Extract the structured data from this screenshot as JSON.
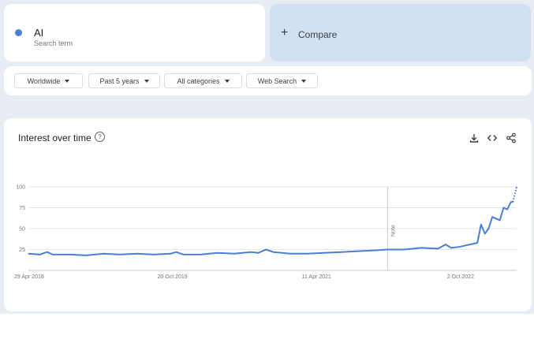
{
  "search_term": {
    "name": "AI",
    "subtitle": "Search term",
    "color": "#4a7fd6"
  },
  "compare": {
    "plus": "+",
    "label": "Compare"
  },
  "filters": [
    {
      "label": "Worldwide"
    },
    {
      "label": "Past 5 years"
    },
    {
      "label": "All categories"
    },
    {
      "label": "Web Search"
    }
  ],
  "chart_card": {
    "title": "Interest over time",
    "help_icon": "?",
    "icons": [
      "download-icon",
      "embed-code-icon",
      "share-icon"
    ]
  },
  "chart_data": {
    "type": "line",
    "title": "",
    "xlabel": "",
    "ylabel": "",
    "ylim": [
      0,
      100
    ],
    "yticks": [
      25,
      50,
      75,
      100
    ],
    "x_start": "29 Apr 2018",
    "x_end": "2023-04-30",
    "x_tick_labels": [
      {
        "label": "29 Apr 2018",
        "date": "2018-04-29"
      },
      {
        "label": "20 Oct 2019",
        "date": "2019-10-20"
      },
      {
        "label": "11 Apr 2021",
        "date": "2021-04-11"
      },
      {
        "label": "2 Oct 2022",
        "date": "2022-10-02"
      }
    ],
    "annotation": {
      "label": "Note",
      "date": "2022-01-02"
    },
    "partial_from": "2023-04-16",
    "grid": true,
    "series": [
      {
        "name": "AI",
        "color": "#4a7fd6",
        "points": [
          [
            "2018-04-29",
            20
          ],
          [
            "2018-06-10",
            19
          ],
          [
            "2018-07-08",
            22
          ],
          [
            "2018-07-29",
            19
          ],
          [
            "2018-09-30",
            19
          ],
          [
            "2018-12-02",
            18
          ],
          [
            "2019-02-03",
            20
          ],
          [
            "2019-04-07",
            19
          ],
          [
            "2019-06-09",
            20
          ],
          [
            "2019-08-11",
            19
          ],
          [
            "2019-10-13",
            20
          ],
          [
            "2019-11-03",
            22
          ],
          [
            "2019-12-01",
            19
          ],
          [
            "2020-02-02",
            19
          ],
          [
            "2020-04-05",
            21
          ],
          [
            "2020-06-07",
            20
          ],
          [
            "2020-08-09",
            22
          ],
          [
            "2020-09-06",
            21
          ],
          [
            "2020-10-04",
            25
          ],
          [
            "2020-11-01",
            22
          ],
          [
            "2021-01-03",
            20
          ],
          [
            "2021-03-07",
            20
          ],
          [
            "2021-05-09",
            21
          ],
          [
            "2021-07-11",
            22
          ],
          [
            "2021-09-12",
            23
          ],
          [
            "2021-11-14",
            24
          ],
          [
            "2022-01-02",
            25
          ],
          [
            "2022-03-06",
            25
          ],
          [
            "2022-05-08",
            27
          ],
          [
            "2022-07-10",
            26
          ],
          [
            "2022-08-07",
            31
          ],
          [
            "2022-08-28",
            27
          ],
          [
            "2022-09-25",
            28
          ],
          [
            "2022-10-23",
            30
          ],
          [
            "2022-11-20",
            32
          ],
          [
            "2022-12-04",
            33
          ],
          [
            "2022-12-18",
            55
          ],
          [
            "2023-01-01",
            44
          ],
          [
            "2023-01-15",
            50
          ],
          [
            "2023-01-29",
            64
          ],
          [
            "2023-02-12",
            62
          ],
          [
            "2023-02-26",
            60
          ],
          [
            "2023-03-12",
            75
          ],
          [
            "2023-03-26",
            73
          ],
          [
            "2023-04-09",
            82
          ],
          [
            "2023-04-16",
            82
          ],
          [
            "2023-04-30",
            100
          ]
        ]
      }
    ]
  }
}
